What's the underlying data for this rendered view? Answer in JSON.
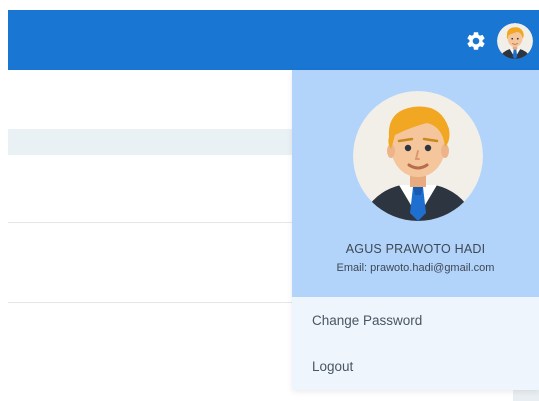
{
  "topbar": {
    "color": "#1976d2",
    "settings_icon": "gear-icon",
    "avatar_icon": "user-avatar-icon"
  },
  "user_menu": {
    "name": "AGUS PRAWOTO HADI",
    "email": "Email: prawoto.hadi@gmail.com",
    "change_password_label": "Change Password",
    "logout_label": "Logout",
    "card_color": "#b3d4fa",
    "menu_bg_color": "#eef5fd"
  }
}
